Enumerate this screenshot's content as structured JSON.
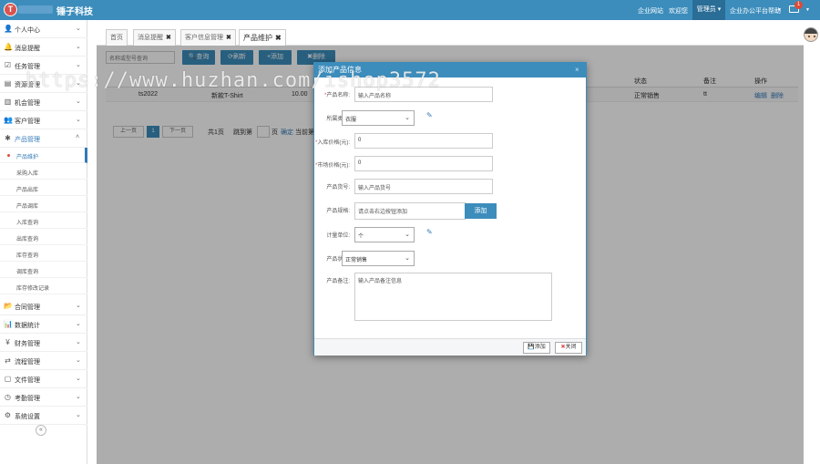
{
  "topbar": {
    "logo_letter": "T",
    "brand": "锤子科技",
    "links": [
      "企业网站",
      "欢迎您"
    ],
    "admin": "管理员",
    "help": "企业办公平台帮助",
    "mail_count": "1"
  },
  "sidebar": {
    "items": [
      {
        "icon": "user-icon",
        "glyph": "👤",
        "label": "个人中心"
      },
      {
        "icon": "bell-icon",
        "glyph": "🔔",
        "label": "消息提醒"
      },
      {
        "icon": "task-icon",
        "glyph": "☑",
        "label": "任务管理"
      },
      {
        "icon": "resource-icon",
        "glyph": "▤",
        "label": "资源管理"
      },
      {
        "icon": "opportunity-icon",
        "glyph": "▥",
        "label": "机会管理"
      },
      {
        "icon": "customer-icon",
        "glyph": "👥",
        "label": "客户管理"
      },
      {
        "icon": "product-icon",
        "glyph": "✱",
        "label": "产品管理"
      }
    ],
    "sub_items": [
      "产品维护",
      "采购入库",
      "产品出库",
      "产品调库",
      "入库查询",
      "出库查询",
      "库存查询",
      "调库查询",
      "库存修改记录"
    ],
    "items_bottom": [
      {
        "icon": "folder-icon",
        "glyph": "📂",
        "label": "合同管理"
      },
      {
        "icon": "chart-icon",
        "glyph": "📊",
        "label": "数据统计"
      },
      {
        "icon": "yen-icon",
        "glyph": "¥",
        "label": "财务管理"
      },
      {
        "icon": "flow-icon",
        "glyph": "⇄",
        "label": "流程管理"
      },
      {
        "icon": "file-icon",
        "glyph": "▢",
        "label": "文件管理"
      },
      {
        "icon": "clock-icon",
        "glyph": "◷",
        "label": "考勤管理"
      },
      {
        "icon": "gear-icon",
        "glyph": "⚙",
        "label": "系统设置"
      }
    ],
    "collapse": "«"
  },
  "tabs": [
    {
      "label": "首页",
      "closable": false
    },
    {
      "label": "消息提醒",
      "closable": true
    },
    {
      "label": "客户信息管理",
      "closable": true
    },
    {
      "label": "产品维护",
      "closable": true
    }
  ],
  "main": {
    "search_placeholder": "名称或型号查询",
    "buttons": [
      "查询",
      "刷新",
      "添加",
      "删除"
    ],
    "columns": [
      "",
      "状态",
      "备注",
      "操作"
    ],
    "row": {
      "code": "ts2022",
      "name": "新款T-Shirt",
      "price": "10.00",
      "status": "正常销售",
      "remark": "tt",
      "edit": "编辑",
      "delete": "删除"
    },
    "pager": {
      "prev": "上一页",
      "current": "1",
      "next": "下一页",
      "total": "共1页",
      "goto": "跳到第",
      "page": "页",
      "confirm": "确定",
      "current_label": "当前第"
    }
  },
  "modal": {
    "title": "添加产品信息",
    "close": "×",
    "fields": {
      "name_label": "产品名称:",
      "name_placeholder": "输入产品名称",
      "category_label": "所属类别:",
      "category_value": "衣服",
      "cost_label": "入库价格(元):",
      "cost_value": "0",
      "market_label": "市场价格(元):",
      "market_value": "0",
      "model_label": "产品货号:",
      "model_placeholder": "输入产品货号",
      "spec_label": "产品规格:",
      "spec_placeholder": "请点击右边按钮添加",
      "spec_button": "添加",
      "unit_label": "计量单位:",
      "unit_value": "个",
      "state_label": "产品状态:",
      "state_value": "正常销售",
      "remark_label": "产品备注:",
      "remark_placeholder": "输入产品备注信息"
    },
    "footer": {
      "add": "添加",
      "close": "关闭"
    }
  },
  "watermark": "https://www.huzhan.com/ishop3572",
  "colors": {
    "primary": "#3c8dbc",
    "danger": "#d9534f"
  }
}
